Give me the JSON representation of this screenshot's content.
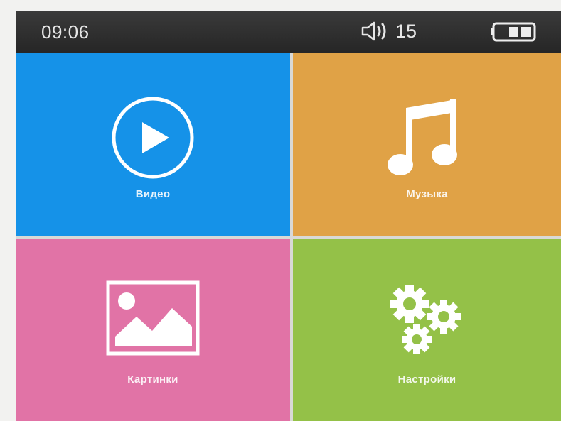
{
  "status_bar": {
    "time": "09:06",
    "volume_icon": "speaker-volume-icon",
    "volume_level": "15",
    "battery_icon": "battery-icon"
  },
  "menu": {
    "video": {
      "label": "Видео",
      "icon": "play-circle-icon",
      "color": "#1592e8"
    },
    "music": {
      "label": "Музыка",
      "icon": "music-note-icon",
      "color": "#e0a246"
    },
    "pictures": {
      "label": "Картинки",
      "icon": "picture-icon",
      "color": "#e173a6"
    },
    "settings": {
      "label": "Настройки",
      "icon": "gears-icon",
      "color": "#94c148"
    }
  }
}
